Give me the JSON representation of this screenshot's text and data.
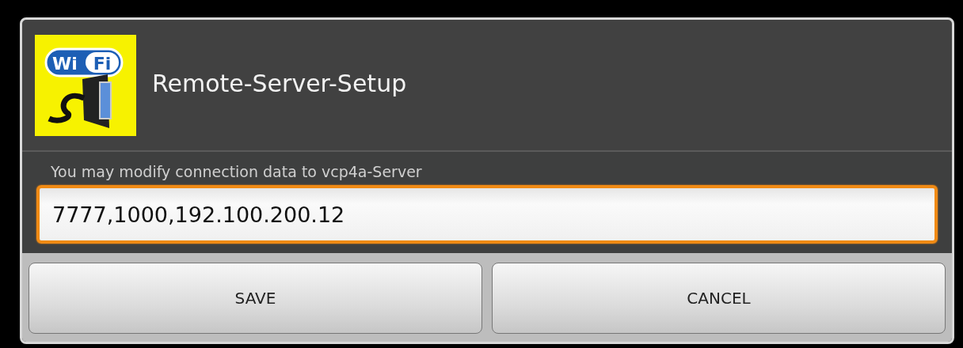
{
  "dialog": {
    "title": "Remote-Server-Setup",
    "icon_labels": [
      "Wi",
      "Fi"
    ],
    "message": "You may modify connection data to vcp4a-Server",
    "field": {
      "value": "7777,1000,192.100.200.12",
      "focused": true
    },
    "buttons": [
      "SAVE",
      "CANCEL"
    ]
  }
}
